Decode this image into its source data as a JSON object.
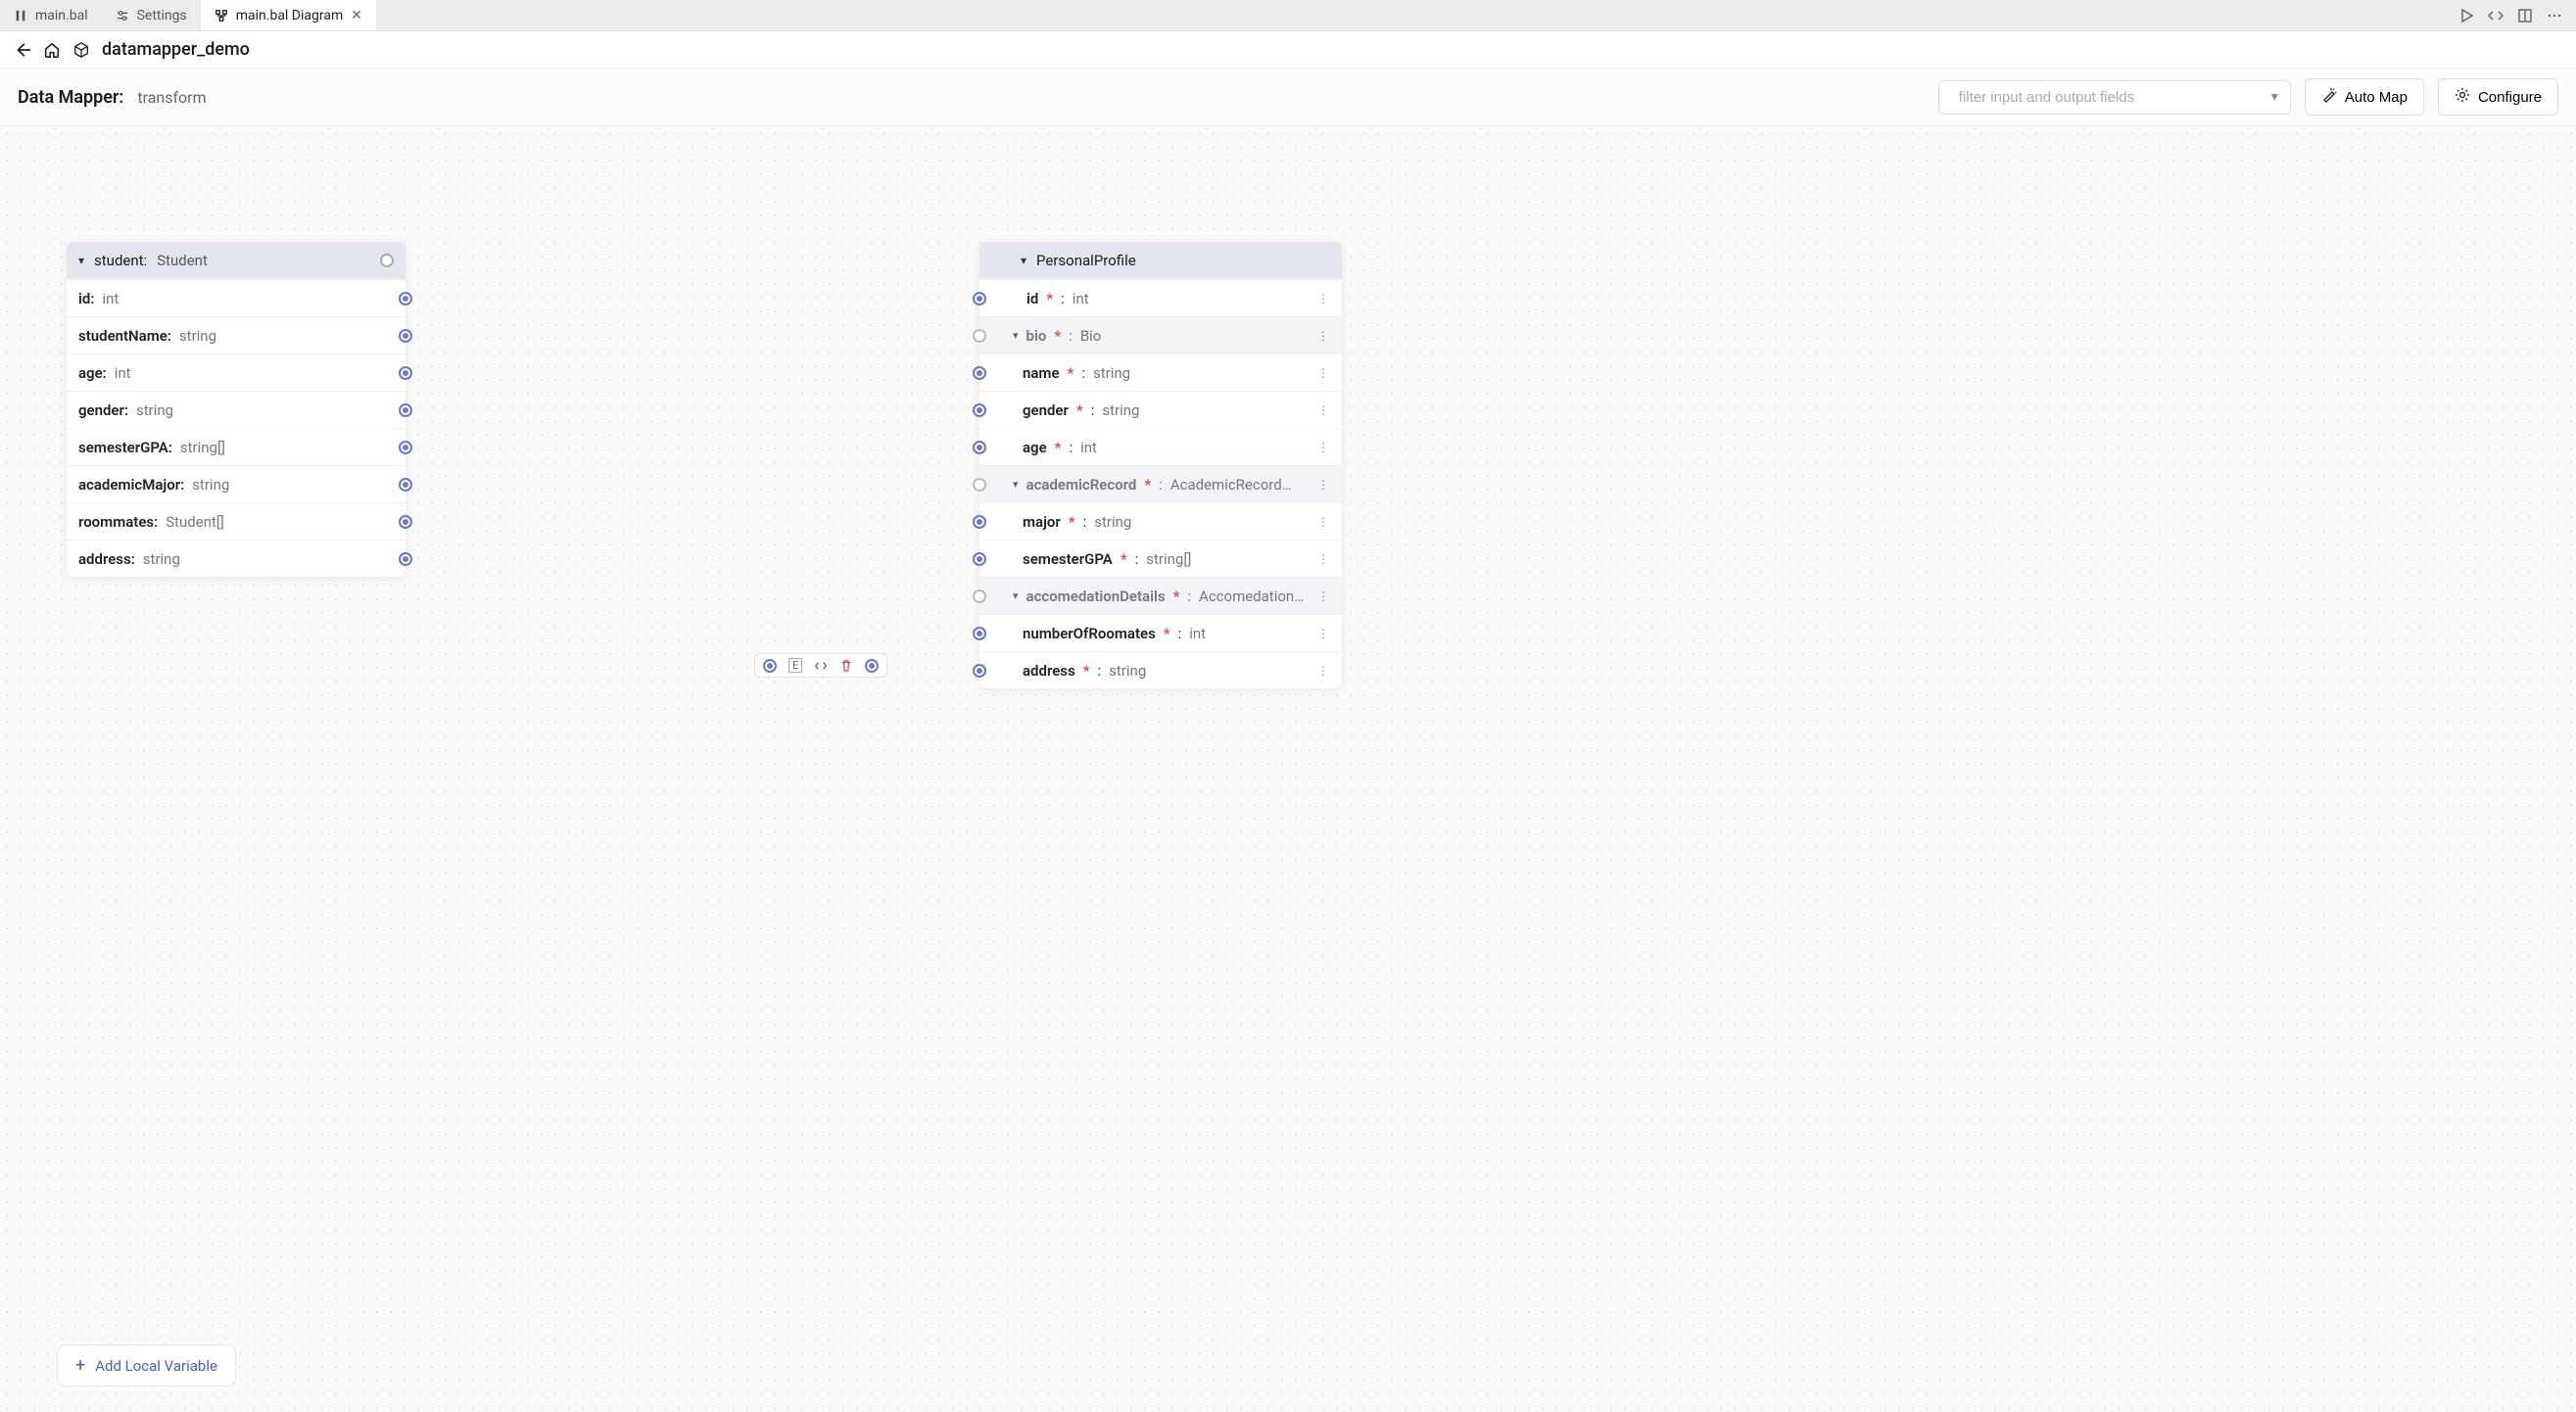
{
  "tabs": {
    "t0": "main.bal",
    "t1": "Settings",
    "t2": "main.bal Diagram"
  },
  "breadcrumb": "datamapper_demo",
  "toolbar": {
    "title": "Data Mapper:",
    "name": "transform",
    "filter_placeholder": "filter input and output fields",
    "automap": "Auto Map",
    "configure": "Configure"
  },
  "input": {
    "header_name": "student:",
    "header_type": "Student",
    "fields": [
      {
        "name": "id:",
        "type": "int"
      },
      {
        "name": "studentName:",
        "type": "string"
      },
      {
        "name": "age:",
        "type": "int"
      },
      {
        "name": "gender:",
        "type": "string"
      },
      {
        "name": "semesterGPA:",
        "type": "string[]"
      },
      {
        "name": "academicMajor:",
        "type": "string"
      },
      {
        "name": "roommates:",
        "type": "Student[]"
      },
      {
        "name": "address:",
        "type": "string"
      }
    ]
  },
  "output": {
    "header": "PersonalProfile",
    "rows": {
      "id": {
        "name": "id",
        "type": "int"
      },
      "bio": {
        "name": "bio",
        "type": "Bio"
      },
      "name": {
        "name": "name",
        "type": "string"
      },
      "gender": {
        "name": "gender",
        "type": "string"
      },
      "age": {
        "name": "age",
        "type": "int"
      },
      "academic": {
        "name": "academicRecord",
        "type": "AcademicRecord…"
      },
      "major": {
        "name": "major",
        "type": "string"
      },
      "sgpa": {
        "name": "semesterGPA",
        "type": "string[]"
      },
      "accom": {
        "name": "accomedationDetails",
        "type": "Accomedation…"
      },
      "nroom": {
        "name": "numberOfRoomates",
        "type": "int"
      },
      "address": {
        "name": "address",
        "type": "string"
      }
    }
  },
  "addvar_label": "Add Local Variable",
  "midnode_label": "E"
}
